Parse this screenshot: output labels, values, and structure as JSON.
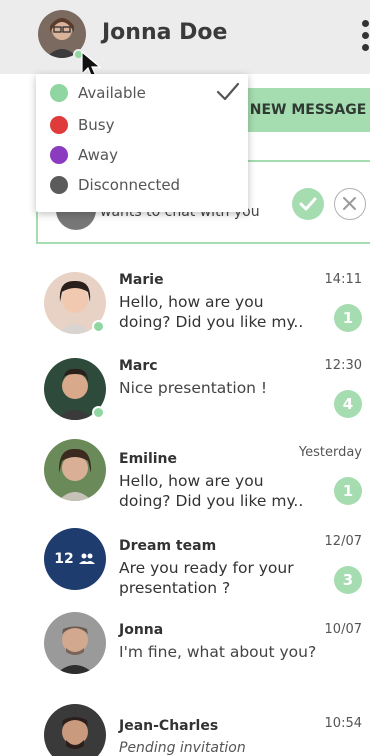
{
  "header": {
    "username": "Jonna Doe",
    "status_color": "#8fd6a0"
  },
  "status_menu": {
    "items": [
      {
        "label": "Available",
        "color": "#8fd6a0",
        "selected": true
      },
      {
        "label": "Busy",
        "color": "#e03b3b",
        "selected": false
      },
      {
        "label": "Away",
        "color": "#8a3bbf",
        "selected": false
      },
      {
        "label": "Disconnected",
        "color": "#5b5b5b",
        "selected": false
      }
    ]
  },
  "actions": {
    "new_message_label": "NEW MESSAGE"
  },
  "invitation_card": {
    "text": "wants to chat with you"
  },
  "conversations": [
    {
      "name": "Marie",
      "time": "14:11",
      "preview": "Hello, how are you doing? Did you like my..",
      "badge": "1",
      "online": true
    },
    {
      "name": "Marc",
      "time": "12:30",
      "preview": "Nice presentation !",
      "badge": "4",
      "online": true
    },
    {
      "name": "Emiline",
      "time": "Yesterday",
      "preview": "Hello, how are you doing? Did you like my..",
      "badge": "1",
      "online": false
    },
    {
      "name": "Dream team",
      "time": "12/07",
      "preview": "Are you ready for your presentation ?",
      "badge": "3",
      "online": false,
      "group_label": "12"
    },
    {
      "name": "Jonna",
      "time": "10/07",
      "preview": "I'm fine, what about you?",
      "badge": "",
      "online": false
    },
    {
      "name": "Jean-Charles",
      "time": "10:54",
      "preview": "Pending invitation",
      "badge": "",
      "online": false
    }
  ],
  "colors": {
    "accent": "#a5dcb0",
    "header_bg": "#ececec",
    "group_avatar_bg": "#1f3c6e"
  }
}
